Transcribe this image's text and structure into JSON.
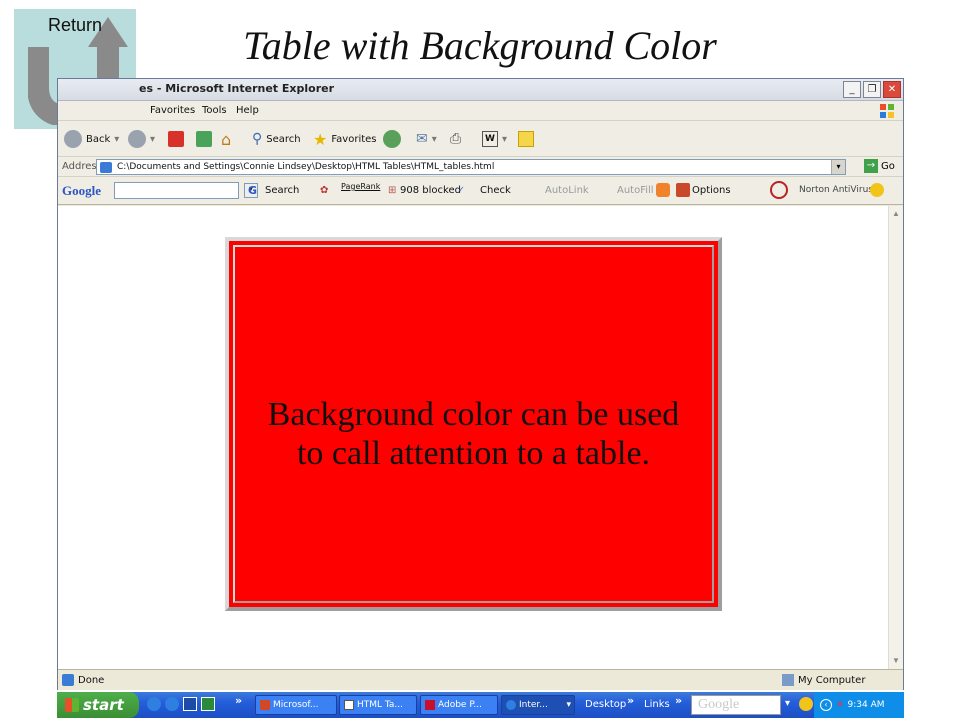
{
  "slide": {
    "return_label": "Return",
    "title": "Table with Background Color"
  },
  "window": {
    "title": "es - Microsoft Internet Explorer",
    "controls": [
      "_",
      "❐",
      "✕"
    ]
  },
  "menu": [
    "Favorites",
    "Tools",
    "Help"
  ],
  "toolbar": {
    "back": "Back",
    "search": "Search",
    "favorites": "Favorites"
  },
  "address": {
    "label": "Address",
    "value": "C:\\Documents and Settings\\Connie Lindsey\\Desktop\\HTML Tables\\HTML_tables.html",
    "go": "Go"
  },
  "google_bar": {
    "logo": "Google",
    "search": "Search",
    "pagerank": "PageRank",
    "blocked": "908 blocked",
    "check": "Check",
    "autolink": "AutoLink",
    "autofill": "AutoFill",
    "options": "Options",
    "antivirus": "Norton AntiVirus"
  },
  "content": {
    "cell_text": "Background color can be used\nto call attention to a table.",
    "cell_color": "#ff0000"
  },
  "status": {
    "left": "Done",
    "zone": "My Computer"
  },
  "taskbar": {
    "start": "start",
    "tasks": [
      "Microsof...",
      "HTML Ta...",
      "Adobe P...",
      "Inter..."
    ],
    "desktop": "Desktop",
    "links": "Links",
    "search_logo": "Google",
    "clock": "9:34 AM"
  }
}
